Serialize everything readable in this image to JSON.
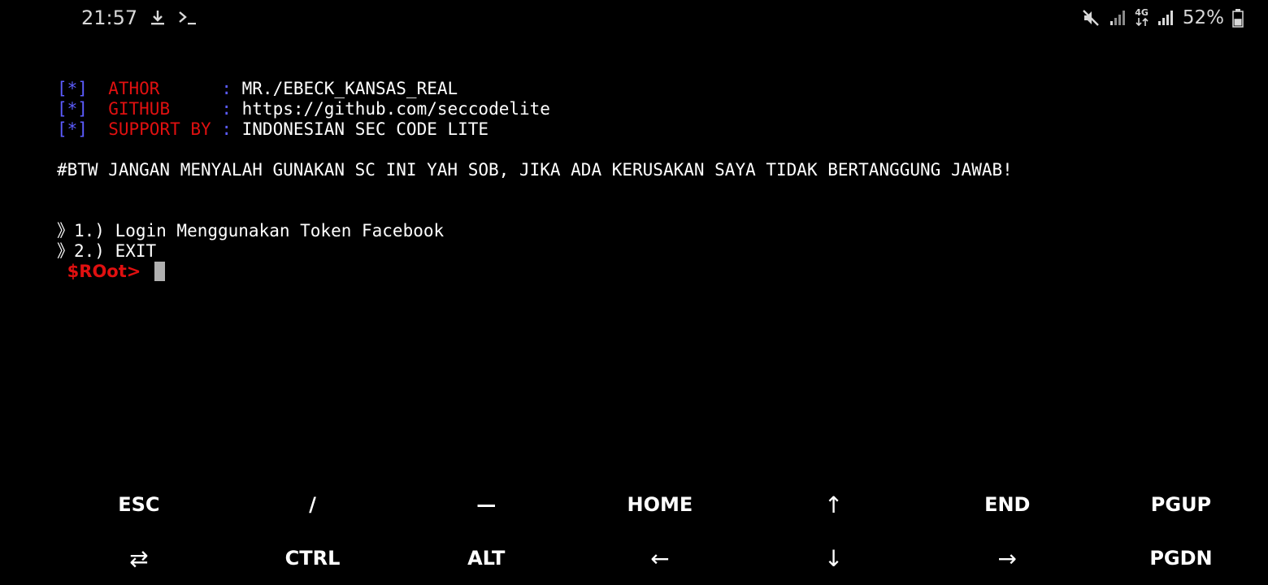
{
  "status_bar": {
    "time": "21:57",
    "icons_left": [
      "download-icon",
      "terminal-icon"
    ],
    "icons_right": [
      "mute-icon",
      "signal-icon",
      "network-4g-icon",
      "signal-icon",
      "battery-icon"
    ],
    "network_label": "4G",
    "battery_percent": "52%",
    "battery_level": 0.52
  },
  "terminal": {
    "info_lines": [
      {
        "bracket": "[*]",
        "key": "ATHOR     ",
        "colon": ":",
        "value": "MR./EBECK_KANSAS_REAL"
      },
      {
        "bracket": "[*]",
        "key": "GITHUB    ",
        "colon": ":",
        "value": "https://github.com/seccodelite"
      },
      {
        "bracket": "[*]",
        "key": "SUPPORT BY",
        "colon": ":",
        "value": "INDONESIAN SEC CODE LITE"
      }
    ],
    "warning": "#BTW JANGAN MENYALAH GUNAKAN SC INI YAH SOB, JIKA ADA KERUSAKAN SAYA TIDAK BERTANGGUNG JAWAB!",
    "menu": [
      "》1.) Login Menggunakan Token Facebook",
      "》2.) EXIT"
    ],
    "prompt": "$ROot>"
  },
  "extra_keys": {
    "row1": [
      "ESC",
      "/",
      "—",
      "HOME",
      "↑",
      "END",
      "PGUP"
    ],
    "row2": [
      "⇄",
      "CTRL",
      "ALT",
      "←",
      "↓",
      "→",
      "PGDN"
    ]
  },
  "colors": {
    "background": "#000000",
    "bracket": "#5c5cff",
    "key": "#e01010",
    "text": "#ffffff"
  }
}
